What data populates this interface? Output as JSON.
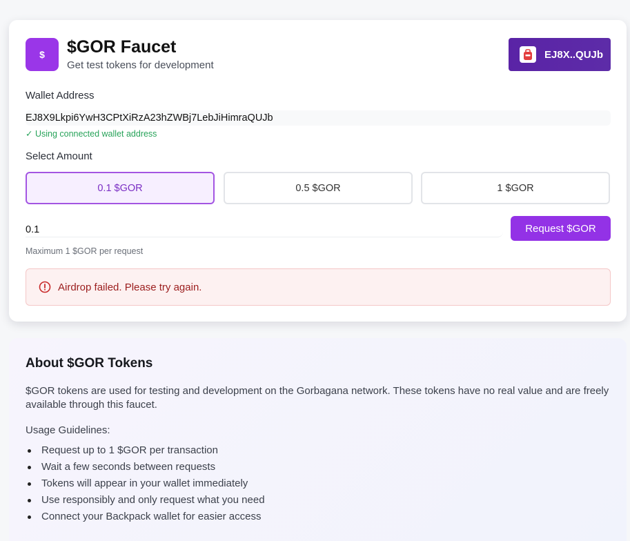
{
  "header": {
    "logo_symbol": "$",
    "title": "$GOR Faucet",
    "subtitle": "Get test tokens for development",
    "wallet_button": "EJ8X..QUJb"
  },
  "form": {
    "wallet_label": "Wallet Address",
    "wallet_value": "EJ8X9Lkpi6YwH3CPtXiRzA23hZWBj7LebJiHimraQUJb",
    "wallet_note": "✓ Using connected wallet address",
    "amount_label": "Select Amount",
    "amount_options": [
      "0.1 $GOR",
      "0.5 $GOR",
      "1 $GOR"
    ],
    "selected_option": "0.1 $GOR",
    "amount_value": "0.1",
    "request_button": "Request $GOR",
    "max_note": "Maximum 1 $GOR per request",
    "error_message": "Airdrop failed. Please try again."
  },
  "about": {
    "heading": "About $GOR Tokens",
    "description": "$GOR tokens are used for testing and development on the Gorbagana network. These tokens have no real value and are freely available through this faucet.",
    "guidelines_label": "Usage Guidelines:",
    "guidelines": [
      "Request up to 1 $GOR per transaction",
      "Wait a few seconds between requests",
      "Tokens will appear in your wallet immediately",
      "Use responsibly and only request what you need",
      "Connect your Backpack wallet for easier access"
    ]
  },
  "colors": {
    "accent": "#9332e6",
    "wallet_button": "#5a23a6",
    "success": "#28a35a",
    "error": "#9b1d1d"
  },
  "icons": {
    "wallet": "backpack-wallet-icon",
    "error": "alert-circle-icon"
  }
}
